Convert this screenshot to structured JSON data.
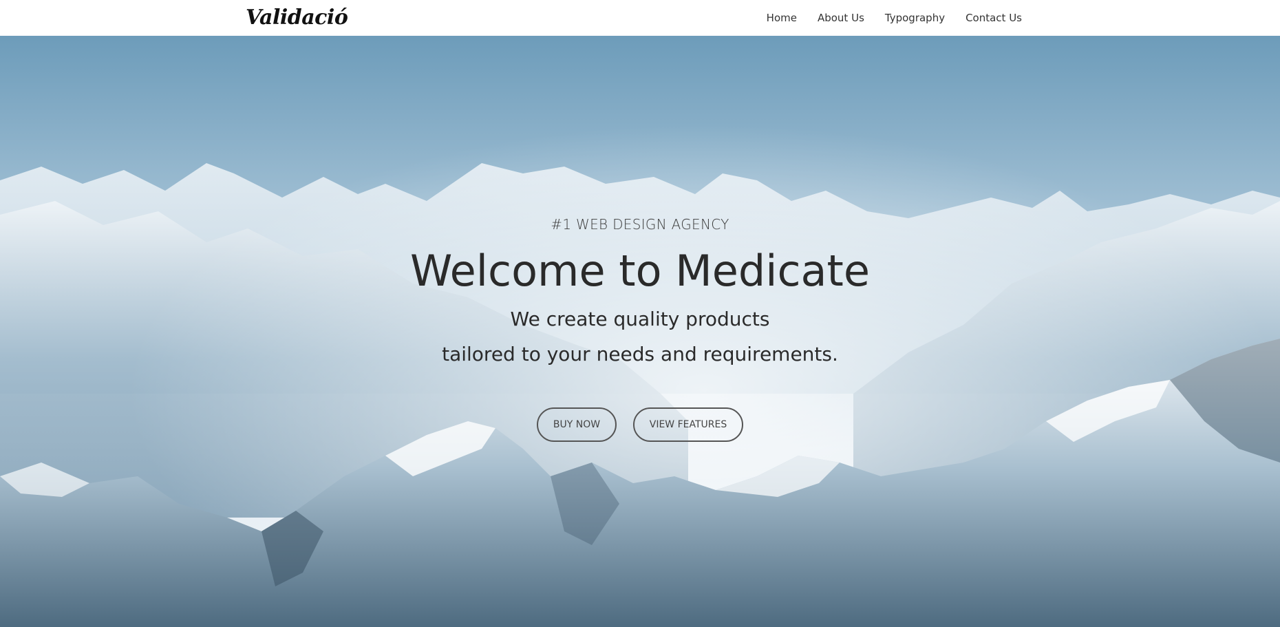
{
  "navbar": {
    "logo_text": "Validació",
    "links": [
      "Home",
      "About Us",
      "Typography",
      "Contact Us"
    ]
  },
  "hero": {
    "eyebrow": "#1 WEB DESIGN AGENCY",
    "headline": "Welcome to Medicate",
    "subline1": "We create quality products",
    "subline2": "tailored to your needs and requirements.",
    "buttons": {
      "buy_now": "BUY NOW",
      "view_features": "VIEW FEATURES"
    },
    "background_image": "snowy-mountains-photo"
  },
  "colors": {
    "sky": "#6f9fbc",
    "mist": "#e6eef4",
    "text": "#2a2a2a",
    "button_border": "#555555"
  }
}
